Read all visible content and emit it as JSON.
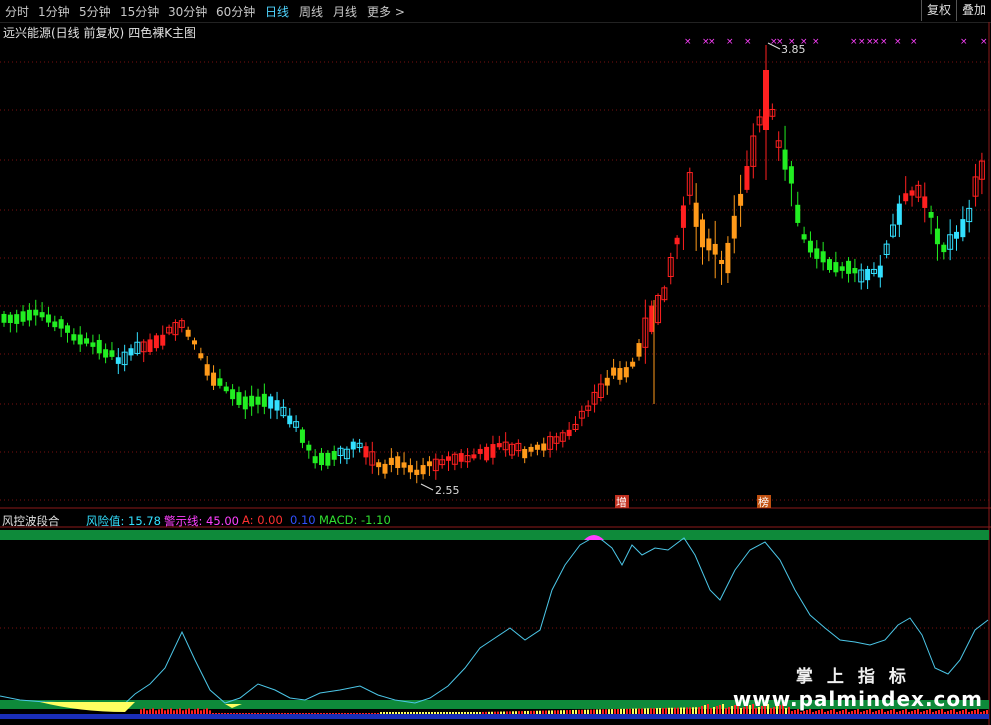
{
  "toolbar": {
    "tabs": [
      "分时",
      "1分钟",
      "5分钟",
      "15分钟",
      "30分钟",
      "60分钟",
      "日线",
      "周线",
      "月线",
      "更多 >"
    ],
    "active_tab": "日线",
    "right_buttons": [
      "复权",
      "叠加"
    ]
  },
  "main_chart": {
    "stock_title": "远兴能源(日线 前复权)",
    "indicator_name": "四色裸K主图",
    "high_label": "3.85",
    "low_label": "2.55",
    "markers": [
      "增",
      "榜"
    ]
  },
  "sub_chart": {
    "indicator_name": "风控波段合",
    "risk_label": "风险值: 15.78",
    "warn_label": "警示线: 45.00",
    "a_label": "A: 0.00",
    "b_label": "0.10",
    "macd_label": "MACD: -1.10"
  },
  "watermark": {
    "line1": "掌上指标",
    "line2": "www.palmindex.com"
  },
  "colors": {
    "red": "#ff2020",
    "orange": "#ff9a1a",
    "green": "#22ee22",
    "cyan": "#33e0ff",
    "magenta": "#ff40ff",
    "band_green": "#0e8a3a",
    "yellow": "#ffff60"
  },
  "chart_data": {
    "type": "candlestick",
    "price_high": 3.85,
    "price_low": 2.55,
    "risk_value": 15.78,
    "warning_line": 45.0,
    "macd": -1.1
  }
}
